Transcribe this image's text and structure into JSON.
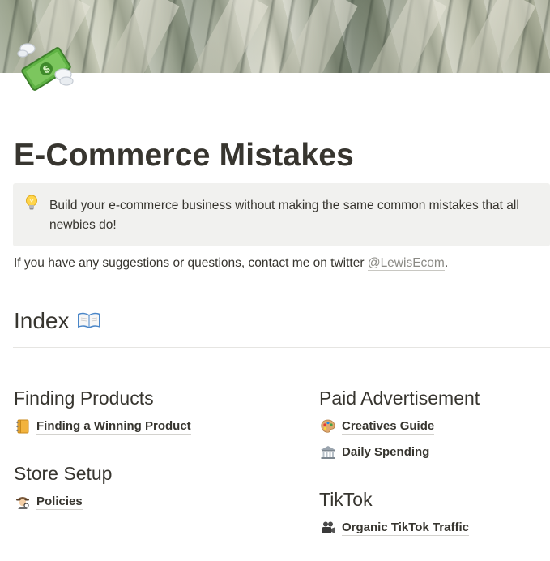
{
  "page": {
    "title": "E-Commerce Mistakes",
    "icon": "money-with-wings-icon"
  },
  "callout": {
    "icon": "light-bulb-icon",
    "text": "Build your e-commerce business without making the same common mistakes that all newbies do!"
  },
  "contact": {
    "prefix": "If you have any suggestions or questions, contact me on twitter ",
    "handle": "@LewisEcom",
    "suffix": "."
  },
  "index": {
    "heading": "Index",
    "icon": "open-book-icon"
  },
  "sections": {
    "finding_products": {
      "heading": "Finding Products",
      "links": [
        {
          "label": "Finding a Winning Product",
          "icon": "notebook-icon"
        }
      ]
    },
    "store_setup": {
      "heading": "Store Setup",
      "links": [
        {
          "label": "Policies",
          "icon": "detective-icon"
        }
      ]
    },
    "paid_advertisement": {
      "heading": "Paid Advertisement",
      "links": [
        {
          "label": "Creatives Guide",
          "icon": "artist-palette-icon"
        },
        {
          "label": "Daily Spending",
          "icon": "bank-icon"
        }
      ]
    },
    "tiktok": {
      "heading": "TikTok",
      "links": [
        {
          "label": "Organic TikTok Traffic",
          "icon": "movie-camera-icon"
        }
      ]
    }
  }
}
